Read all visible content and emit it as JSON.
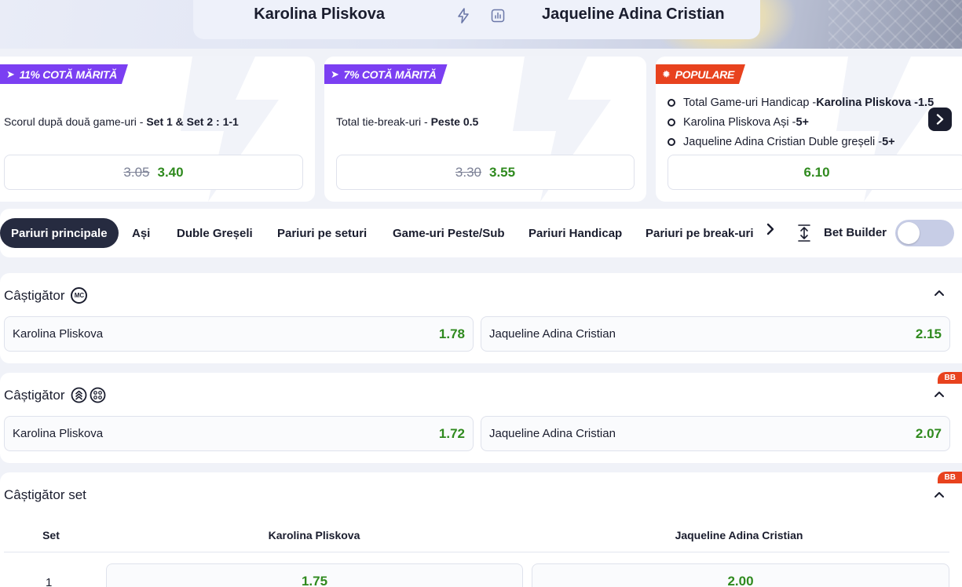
{
  "header": {
    "home_team": "Karolina Pliskova",
    "away_team": "Jaqueline Adina Cristian"
  },
  "promos": [
    {
      "tag": "11% COTĂ MĂRITĂ",
      "desc_prefix": "Scorul după două game-uri - ",
      "desc_bold": "Set 1 & Set 2 : 1-1",
      "old_odd": "3.05",
      "new_odd": "3.40"
    },
    {
      "tag": "7% COTĂ MĂRITĂ",
      "desc_prefix": "Total tie-break-uri - ",
      "desc_bold": "Peste 0.5",
      "old_odd": "3.30",
      "new_odd": "3.55"
    }
  ],
  "popular": {
    "tag": "POPULARE",
    "items": [
      {
        "text": "Total Game-uri Handicap - ",
        "bold": "Karolina Pliskova -1.5"
      },
      {
        "text": "Karolina Pliskova Ași - ",
        "bold": "5+"
      },
      {
        "text": "Jaqueline Adina Cristian Duble greșeli - ",
        "bold": "5+"
      }
    ],
    "odd": "6.10"
  },
  "tabs": [
    {
      "label": "Pariuri principale",
      "active": true
    },
    {
      "label": "Ași"
    },
    {
      "label": "Duble Greșeli"
    },
    {
      "label": "Pariuri pe seturi"
    },
    {
      "label": "Game-uri Peste/Sub"
    },
    {
      "label": "Pariuri Handicap"
    },
    {
      "label": "Pariuri pe break-uri"
    }
  ],
  "bet_builder": {
    "label": "Bet Builder",
    "enabled": false
  },
  "markets": [
    {
      "title": "Câștigător",
      "badge": "MC",
      "selections": [
        {
          "name": "Karolina Pliskova",
          "odd": "1.78"
        },
        {
          "name": "Jaqueline Adina Cristian",
          "odd": "2.15"
        }
      ]
    },
    {
      "title": "Câștigător",
      "bb_tag": "BB",
      "selections": [
        {
          "name": "Karolina Pliskova",
          "odd": "1.72"
        },
        {
          "name": "Jaqueline Adina Cristian",
          "odd": "2.07"
        }
      ]
    },
    {
      "title": "Câștigător set",
      "bb_tag": "BB",
      "columns": [
        "Set",
        "Karolina Pliskova",
        "Jaqueline Adina Cristian"
      ],
      "rows": [
        {
          "set": "1",
          "home": "1.75",
          "away": "2.00"
        }
      ]
    }
  ],
  "colors": {
    "odd_green": "#2f8a1e",
    "boost_purple": "#7b3ff2",
    "popular_red": "#e8421e",
    "dark": "#1a1d2e"
  }
}
